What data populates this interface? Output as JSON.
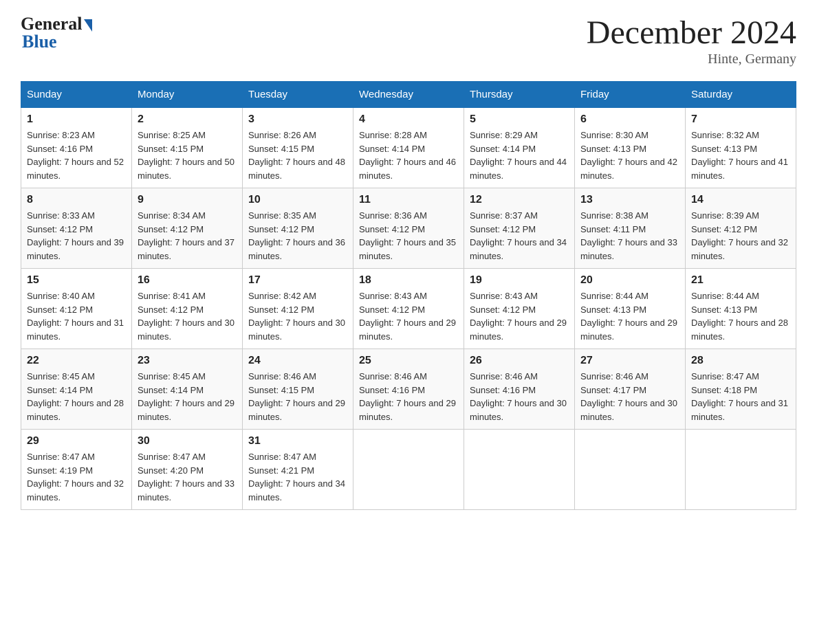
{
  "header": {
    "logo_general": "General",
    "logo_blue": "Blue",
    "month_title": "December 2024",
    "location": "Hinte, Germany"
  },
  "weekdays": [
    "Sunday",
    "Monday",
    "Tuesday",
    "Wednesday",
    "Thursday",
    "Friday",
    "Saturday"
  ],
  "weeks": [
    [
      {
        "day": "1",
        "sunrise": "8:23 AM",
        "sunset": "4:16 PM",
        "daylight": "7 hours and 52 minutes."
      },
      {
        "day": "2",
        "sunrise": "8:25 AM",
        "sunset": "4:15 PM",
        "daylight": "7 hours and 50 minutes."
      },
      {
        "day": "3",
        "sunrise": "8:26 AM",
        "sunset": "4:15 PM",
        "daylight": "7 hours and 48 minutes."
      },
      {
        "day": "4",
        "sunrise": "8:28 AM",
        "sunset": "4:14 PM",
        "daylight": "7 hours and 46 minutes."
      },
      {
        "day": "5",
        "sunrise": "8:29 AM",
        "sunset": "4:14 PM",
        "daylight": "7 hours and 44 minutes."
      },
      {
        "day": "6",
        "sunrise": "8:30 AM",
        "sunset": "4:13 PM",
        "daylight": "7 hours and 42 minutes."
      },
      {
        "day": "7",
        "sunrise": "8:32 AM",
        "sunset": "4:13 PM",
        "daylight": "7 hours and 41 minutes."
      }
    ],
    [
      {
        "day": "8",
        "sunrise": "8:33 AM",
        "sunset": "4:12 PM",
        "daylight": "7 hours and 39 minutes."
      },
      {
        "day": "9",
        "sunrise": "8:34 AM",
        "sunset": "4:12 PM",
        "daylight": "7 hours and 37 minutes."
      },
      {
        "day": "10",
        "sunrise": "8:35 AM",
        "sunset": "4:12 PM",
        "daylight": "7 hours and 36 minutes."
      },
      {
        "day": "11",
        "sunrise": "8:36 AM",
        "sunset": "4:12 PM",
        "daylight": "7 hours and 35 minutes."
      },
      {
        "day": "12",
        "sunrise": "8:37 AM",
        "sunset": "4:12 PM",
        "daylight": "7 hours and 34 minutes."
      },
      {
        "day": "13",
        "sunrise": "8:38 AM",
        "sunset": "4:11 PM",
        "daylight": "7 hours and 33 minutes."
      },
      {
        "day": "14",
        "sunrise": "8:39 AM",
        "sunset": "4:12 PM",
        "daylight": "7 hours and 32 minutes."
      }
    ],
    [
      {
        "day": "15",
        "sunrise": "8:40 AM",
        "sunset": "4:12 PM",
        "daylight": "7 hours and 31 minutes."
      },
      {
        "day": "16",
        "sunrise": "8:41 AM",
        "sunset": "4:12 PM",
        "daylight": "7 hours and 30 minutes."
      },
      {
        "day": "17",
        "sunrise": "8:42 AM",
        "sunset": "4:12 PM",
        "daylight": "7 hours and 30 minutes."
      },
      {
        "day": "18",
        "sunrise": "8:43 AM",
        "sunset": "4:12 PM",
        "daylight": "7 hours and 29 minutes."
      },
      {
        "day": "19",
        "sunrise": "8:43 AM",
        "sunset": "4:12 PM",
        "daylight": "7 hours and 29 minutes."
      },
      {
        "day": "20",
        "sunrise": "8:44 AM",
        "sunset": "4:13 PM",
        "daylight": "7 hours and 29 minutes."
      },
      {
        "day": "21",
        "sunrise": "8:44 AM",
        "sunset": "4:13 PM",
        "daylight": "7 hours and 28 minutes."
      }
    ],
    [
      {
        "day": "22",
        "sunrise": "8:45 AM",
        "sunset": "4:14 PM",
        "daylight": "7 hours and 28 minutes."
      },
      {
        "day": "23",
        "sunrise": "8:45 AM",
        "sunset": "4:14 PM",
        "daylight": "7 hours and 29 minutes."
      },
      {
        "day": "24",
        "sunrise": "8:46 AM",
        "sunset": "4:15 PM",
        "daylight": "7 hours and 29 minutes."
      },
      {
        "day": "25",
        "sunrise": "8:46 AM",
        "sunset": "4:16 PM",
        "daylight": "7 hours and 29 minutes."
      },
      {
        "day": "26",
        "sunrise": "8:46 AM",
        "sunset": "4:16 PM",
        "daylight": "7 hours and 30 minutes."
      },
      {
        "day": "27",
        "sunrise": "8:46 AM",
        "sunset": "4:17 PM",
        "daylight": "7 hours and 30 minutes."
      },
      {
        "day": "28",
        "sunrise": "8:47 AM",
        "sunset": "4:18 PM",
        "daylight": "7 hours and 31 minutes."
      }
    ],
    [
      {
        "day": "29",
        "sunrise": "8:47 AM",
        "sunset": "4:19 PM",
        "daylight": "7 hours and 32 minutes."
      },
      {
        "day": "30",
        "sunrise": "8:47 AM",
        "sunset": "4:20 PM",
        "daylight": "7 hours and 33 minutes."
      },
      {
        "day": "31",
        "sunrise": "8:47 AM",
        "sunset": "4:21 PM",
        "daylight": "7 hours and 34 minutes."
      },
      null,
      null,
      null,
      null
    ]
  ]
}
